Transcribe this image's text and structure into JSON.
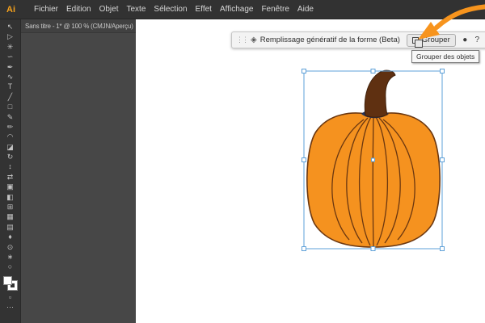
{
  "menu_bar": {
    "logo_text": "Ai",
    "items": [
      "Fichier",
      "Edition",
      "Objet",
      "Texte",
      "Sélection",
      "Effet",
      "Affichage",
      "Fenêtre",
      "Aide"
    ]
  },
  "document_tab": {
    "label": "Sans titre - 1* @ 100 % (CMJN/Aperçu)",
    "close_glyph": "×"
  },
  "tools": [
    {
      "name": "selection-tool-icon",
      "glyph": "↖"
    },
    {
      "name": "direct-selection-tool-icon",
      "glyph": "▷"
    },
    {
      "name": "magic-wand-tool-icon",
      "glyph": "✳"
    },
    {
      "name": "lasso-tool-icon",
      "glyph": "∽"
    },
    {
      "name": "pen-tool-icon",
      "glyph": "✒"
    },
    {
      "name": "curvature-tool-icon",
      "glyph": "∿"
    },
    {
      "name": "type-tool-icon",
      "glyph": "T"
    },
    {
      "name": "line-segment-tool-icon",
      "glyph": "╱"
    },
    {
      "name": "rectangle-tool-icon",
      "glyph": "□"
    },
    {
      "name": "paintbrush-tool-icon",
      "glyph": "✎"
    },
    {
      "name": "pencil-tool-icon",
      "glyph": "✏"
    },
    {
      "name": "shaper-tool-icon",
      "glyph": "◠"
    },
    {
      "name": "eraser-tool-icon",
      "glyph": "◪"
    },
    {
      "name": "rotate-tool-icon",
      "glyph": "↻"
    },
    {
      "name": "scale-tool-icon",
      "glyph": "↕"
    },
    {
      "name": "width-tool-icon",
      "glyph": "⇄"
    },
    {
      "name": "free-transform-tool-icon",
      "glyph": "▣"
    },
    {
      "name": "shape-builder-tool-icon",
      "glyph": "◧"
    },
    {
      "name": "perspective-grid-tool-icon",
      "glyph": "⊞"
    },
    {
      "name": "mesh-tool-icon",
      "glyph": "▦"
    },
    {
      "name": "gradient-tool-icon",
      "glyph": "▤"
    },
    {
      "name": "eyedropper-tool-icon",
      "glyph": "♦"
    },
    {
      "name": "blend-tool-icon",
      "glyph": "⊙"
    },
    {
      "name": "symbol-sprayer-tool-icon",
      "glyph": "∗"
    },
    {
      "name": "zoom-tool-icon",
      "glyph": "○"
    }
  ],
  "toolbar_bottom": {
    "extra_icons": [
      {
        "name": "drawing-mode-icon",
        "glyph": "▫"
      },
      {
        "name": "toolbar-more-icon",
        "glyph": "⋯"
      }
    ]
  },
  "context_bar": {
    "drag_handle_glyph": "⋮⋮",
    "generative_fill": {
      "icon_glyph": "◈",
      "label": "Remplissage génératif de la forme (Beta)"
    },
    "group_button": {
      "label": "Grouper"
    },
    "trailing_icons": [
      {
        "name": "globe-icon",
        "glyph": "●"
      },
      {
        "name": "help-icon",
        "glyph": "?"
      },
      {
        "name": "more-options-icon",
        "glyph": "⋯"
      },
      {
        "name": "collapse-icon",
        "glyph": "≡"
      }
    ]
  },
  "tooltip": {
    "text": "Grouper des objets"
  },
  "colors": {
    "menubar_bg": "#323232",
    "toolbar_bg": "#333333",
    "pasteboard_bg": "#474747",
    "artboard_bg": "#ffffff",
    "accent_selection": "#5ea0d8",
    "pumpkin_body": "#f5921f",
    "pumpkin_outline": "#6b3710",
    "stem_fill": "#5f3011",
    "stem_outline": "#40200a",
    "collar_fill": "#24335a",
    "fill_swatch": "#ffffff",
    "stroke_swatch": "#ffffff",
    "annotation_arrow": "#f7941d"
  }
}
